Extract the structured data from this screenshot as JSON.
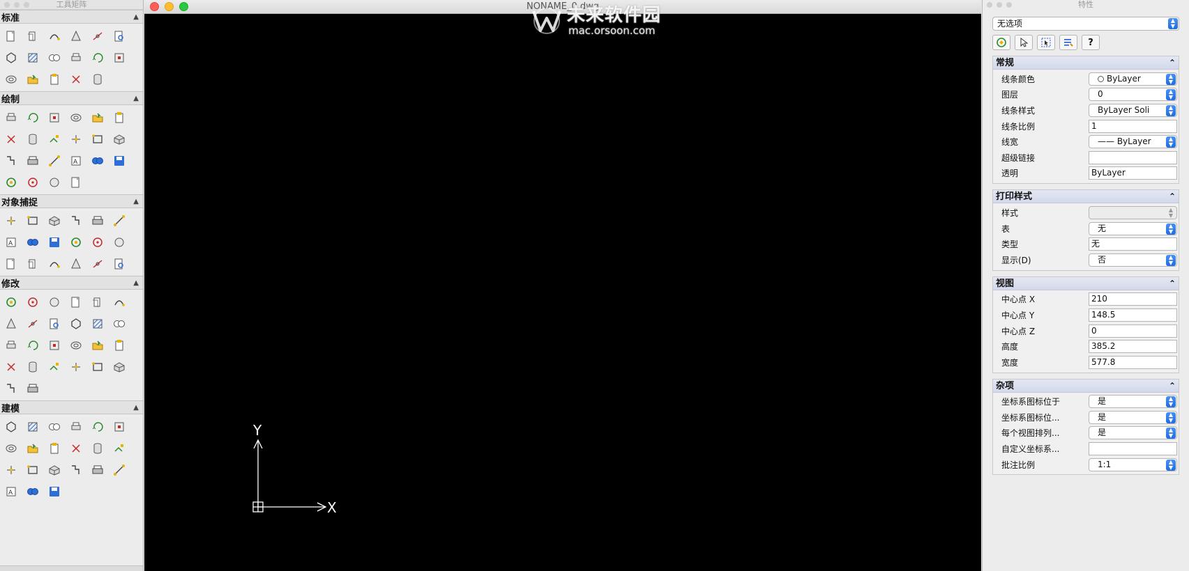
{
  "palette": {
    "title": "工具矩阵",
    "sections": [
      {
        "id": "standard",
        "label": "标准",
        "tools": [
          "new",
          "open",
          "save",
          "print",
          "plot",
          "preview",
          "cut",
          "copy",
          "paste",
          "match",
          "undo",
          "redo",
          "pan",
          "zoom",
          "zoom-realtime",
          "layers",
          "browser"
        ]
      },
      {
        "id": "draw",
        "label": "绘制",
        "tools": [
          "line",
          "ray",
          "polygon",
          "rectangle",
          "arc",
          "spline",
          "circle",
          "ellipse",
          "pline",
          "pointarray",
          "construct",
          "stairs",
          "insert",
          "hatch",
          "attribute",
          "region",
          "text",
          "mtext",
          "revcloud",
          "wipeout",
          "cloud",
          "blob"
        ]
      },
      {
        "id": "snap",
        "label": "对象捕捉",
        "tools": [
          "endpoint",
          "midpoint",
          "intersection",
          "apparent",
          "extension",
          "perpendicular",
          "nearest",
          "center",
          "node",
          "quadrant",
          "tangent",
          "insertion",
          "parallel",
          "parallel2",
          "apparent2",
          "nearest2",
          "snapclear",
          "snapset"
        ]
      },
      {
        "id": "modify",
        "label": "修改",
        "tools": [
          "erase",
          "delete-dup",
          "move",
          "mirror",
          "scale",
          "offset",
          "array",
          "rotate",
          "stretch",
          "align",
          "explode",
          "fillet",
          "break",
          "chamfer",
          "join",
          "extend",
          "trim",
          "cutter",
          "rtrim",
          "rotate2",
          "edit3d",
          "copy3d",
          "lengthen",
          "scale3d",
          "boundary",
          "group"
        ]
      },
      {
        "id": "model",
        "label": "建模",
        "tools": [
          "box",
          "cone",
          "cylinder",
          "pyramid",
          "sphere",
          "torus",
          "wedge",
          "extrude",
          "revolve",
          "loft",
          "sweep",
          "slice",
          "interfere",
          "sweep2",
          "union",
          "subtract",
          "intersect",
          "section",
          "polysolid",
          "solidedit",
          "shell"
        ]
      }
    ]
  },
  "drawing": {
    "title": "NONAME_0.dwg",
    "watermark_big": "未来软件园",
    "watermark_small": "mac.orsoon.com",
    "ucs_x_label": "X",
    "ucs_y_label": "Y"
  },
  "props": {
    "title": "特性",
    "selection": "无选项",
    "toolbar_help": "?",
    "groups": [
      {
        "title": "常规",
        "rows": [
          {
            "label": "线条颜色",
            "value": "ByLayer",
            "kind": "combo-color"
          },
          {
            "label": "图层",
            "value": "0",
            "kind": "combo"
          },
          {
            "label": "线条样式",
            "value": "ByLayer    Soli",
            "kind": "combo"
          },
          {
            "label": "线条比例",
            "value": "1",
            "kind": "field"
          },
          {
            "label": "线宽",
            "value": "—— ByLayer",
            "kind": "combo"
          },
          {
            "label": "超级链接",
            "value": "",
            "kind": "field"
          },
          {
            "label": "透明",
            "value": "ByLayer",
            "kind": "field"
          }
        ]
      },
      {
        "title": "打印样式",
        "rows": [
          {
            "label": "样式",
            "value": "",
            "kind": "combo-disabled"
          },
          {
            "label": "表",
            "value": "无",
            "kind": "combo"
          },
          {
            "label": "类型",
            "value": "无",
            "kind": "field"
          },
          {
            "label": "显示(D)",
            "value": "否",
            "kind": "combo"
          }
        ]
      },
      {
        "title": "视图",
        "rows": [
          {
            "label": "中心点 X",
            "value": "210",
            "kind": "field"
          },
          {
            "label": "中心点 Y",
            "value": "148.5",
            "kind": "field"
          },
          {
            "label": "中心点 Z",
            "value": "0",
            "kind": "field"
          },
          {
            "label": "高度",
            "value": "385.2",
            "kind": "field"
          },
          {
            "label": "宽度",
            "value": "577.8",
            "kind": "field"
          }
        ]
      },
      {
        "title": "杂项",
        "rows": [
          {
            "label": "坐标系图标位于",
            "value": "是",
            "kind": "combo"
          },
          {
            "label": "坐标系图标位...",
            "value": "是",
            "kind": "combo"
          },
          {
            "label": "每个视图排列...",
            "value": "是",
            "kind": "combo"
          },
          {
            "label": "自定义坐标系...",
            "value": "",
            "kind": "field"
          },
          {
            "label": "批注比例",
            "value": "1:1",
            "kind": "combo"
          }
        ]
      }
    ]
  }
}
